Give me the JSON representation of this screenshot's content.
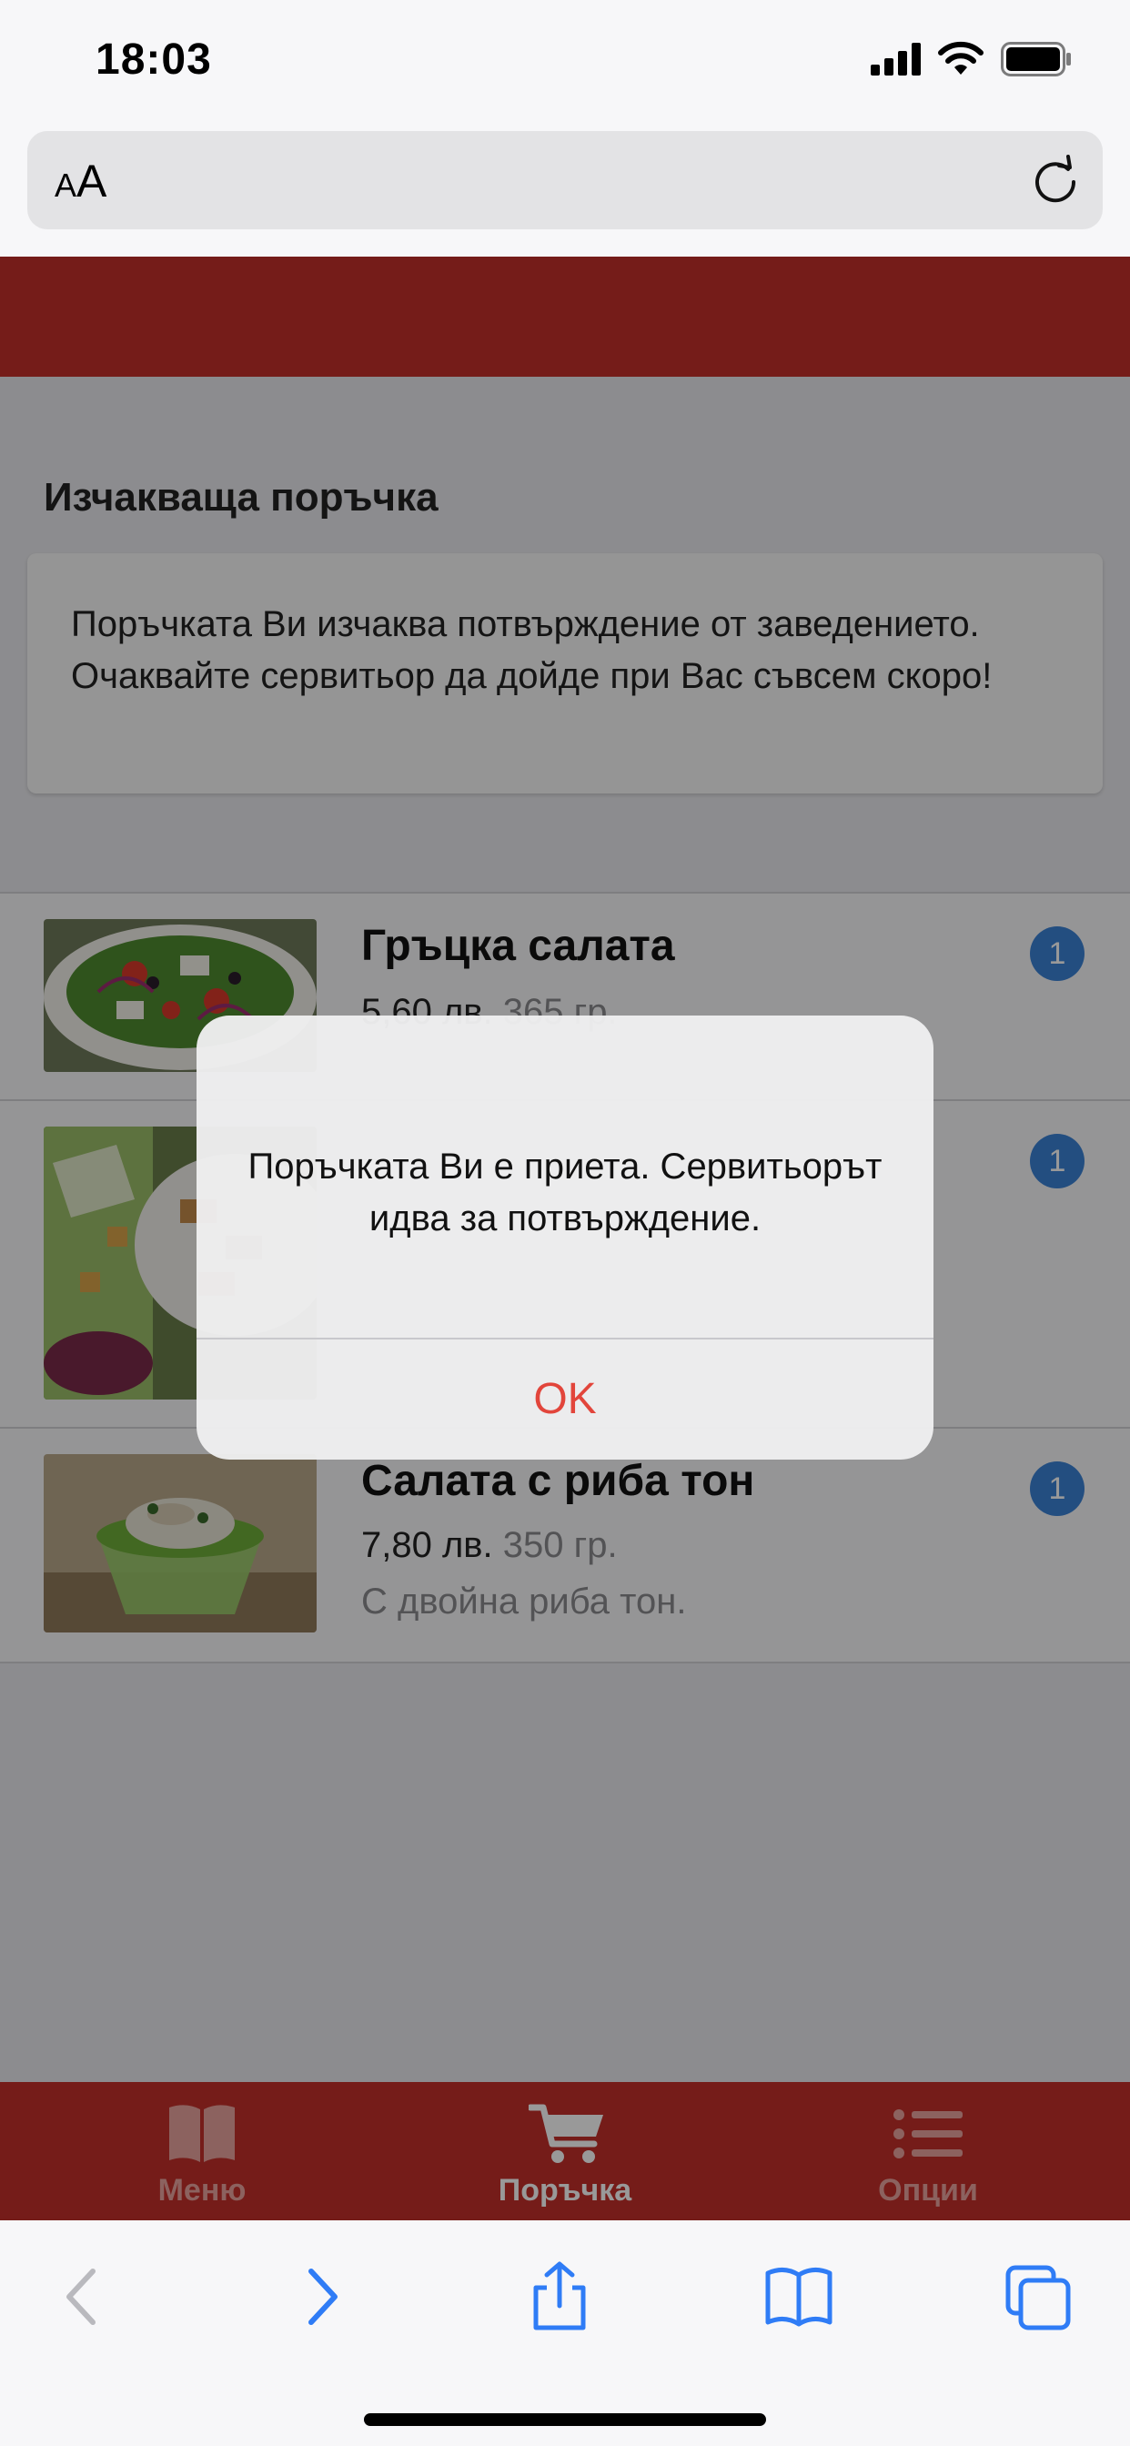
{
  "status_bar": {
    "time": "18:03"
  },
  "address_bar": {
    "text_size_small": "A",
    "text_size_large": "A"
  },
  "pending_order": {
    "title": "Изчакваща поръчка",
    "message": "Поръчката Ви изчаква потвърждение от заведението. Очаквайте сервитьор да дойде при Вас съвсем скоро!"
  },
  "order_items": [
    {
      "name": "Гръцка салата",
      "price": "5,60 лв.",
      "weight": "365 гр.",
      "description": "",
      "quantity": "1"
    },
    {
      "name": "",
      "price": "",
      "weight": "",
      "description": "",
      "quantity": "1"
    },
    {
      "name": "Салата с риба тон",
      "price": "7,80 лв.",
      "weight": "350 гр.",
      "description": "С двойна риба тон.",
      "quantity": "1"
    }
  ],
  "tab_bar": {
    "tabs": [
      {
        "label": "Меню",
        "icon": "book-icon",
        "active": false
      },
      {
        "label": "Поръчка",
        "icon": "cart-icon",
        "active": true
      },
      {
        "label": "Опции",
        "icon": "list-icon",
        "active": false
      }
    ]
  },
  "alert": {
    "message": "Поръчката Ви е приета. Сервитьорът идва за потвърждение.",
    "ok_label": "OK"
  },
  "colors": {
    "brand_red": "#c4302b",
    "badge_blue": "#3b82d6",
    "alert_button_red": "#e2453b",
    "ios_blue": "#2f7cf6"
  }
}
